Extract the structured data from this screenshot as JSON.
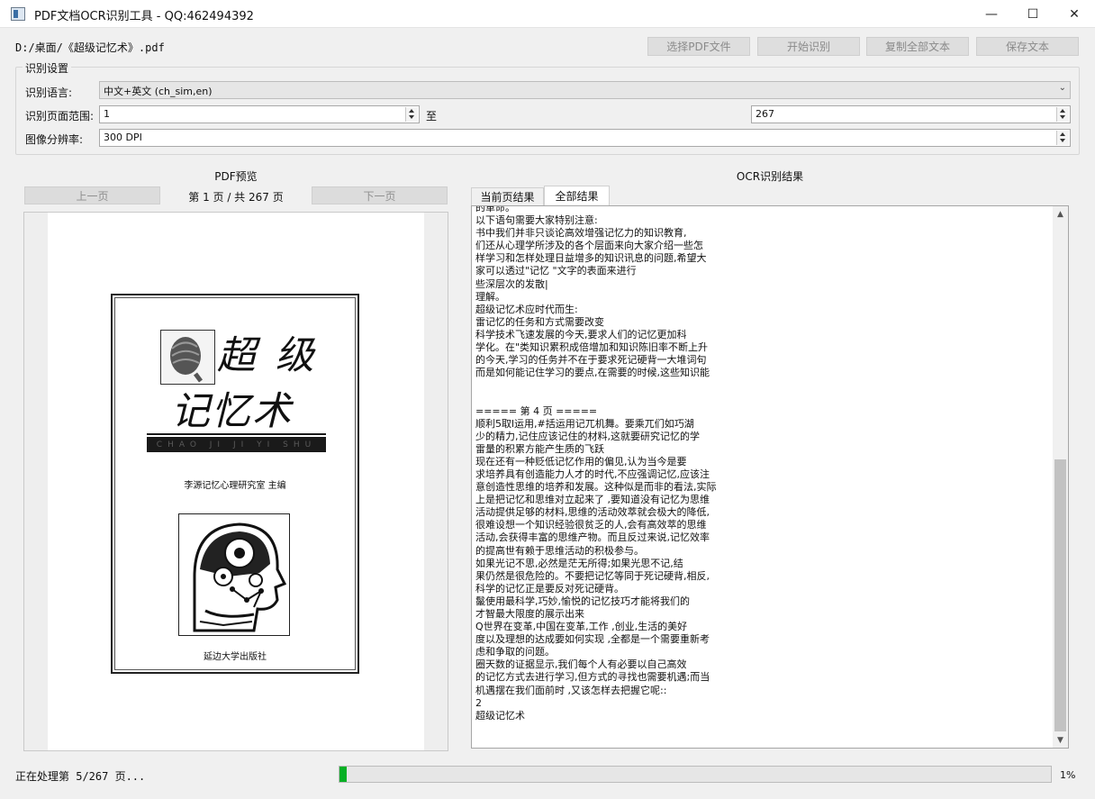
{
  "window": {
    "title": "PDF文档OCR识别工具 - QQ:462494392",
    "minimize": "—",
    "maximize": "☐",
    "close": "✕",
    "icon": "app-icon"
  },
  "toolbar": {
    "file_path": "D:/桌面/《超级记忆术》.pdf",
    "select_pdf": "选择PDF文件",
    "start": "开始识别",
    "copy_all": "复制全部文本",
    "save": "保存文本"
  },
  "settings": {
    "group_title": "识别设置",
    "language_label": "识别语言:",
    "language_value": "中文+英文 (ch_sim,en)",
    "range_label": "识别页面范围:",
    "range_from": "1",
    "range_to_label": "至",
    "range_to": "267",
    "dpi_label": "图像分辨率:",
    "dpi_value": "300 DPI"
  },
  "preview": {
    "title": "PDF预览",
    "prev_button": "上一页",
    "next_button": "下一页",
    "page_info": "第 1 页 / 共 267 页",
    "cover": {
      "title_line1": "超 级",
      "title_line2": "记忆术",
      "pinyin": "CHAO JI JI YI SHU",
      "editor": "李源记忆心理研究室  主编",
      "publisher": "延边大学出版社"
    }
  },
  "ocr": {
    "title": "OCR识别结果",
    "tab_current": "当前页结果",
    "tab_all": "全部结果",
    "text_lines": [
      "的革命。",
      "以下语句需要大家特别注意:",
      "书中我们并非只谈论高效增强记忆力的知识教育,",
      "们还从心理学所涉及的各个层面来向大家介绍一些怎",
      "样学习和怎样处理日益增多的知识讯息的问题,希望大",
      "家可以透过\"记忆 \"文字的表面来进行",
      "些深层次的发散|",
      "理解。",
      "超级记忆术应时代而生:",
      "雷记忆的任务和方式需要改变",
      "科学技术飞速发展的今天,要求人们的记忆更加科",
      "学化。在\"类知识累积成倍增加和知识陈旧率不断上升",
      "的今天,学习的任务并不在于要求死记硬背一大堆词句",
      "而是如何能记住学习的要点,在需要的时候,这些知识能",
      "",
      "",
      "===== 第 4 页 =====",
      "顺利5取l运用,#括运用记兀机舞。要乘兀们如巧湖",
      "少的精力,记住应该记住的材料,这就要研究记忆的学",
      "雷量的积累方能产生质的飞跃",
      "现在还有一种贬低记忆作用的偏见,认为当今是要",
      "求培养具有创造能力人才的时代,不应强调记忆,应该注",
      "意创造性思维的培养和发展。这种似是而非的看法,实际",
      "上是把记忆和思维对立起来了 ,要知道没有记忆为思维",
      "活动提供足够的材料,思维的活动效萃就会极大的降低,",
      "很难设想一个知识经验很贫乏的人,会有高效萃的思维",
      "活动,会获得丰富的思维产物。而且反过来说,记忆效率",
      "的提高世有赖于思维活动的积极参与。",
      "如果光记不思,必然是茫无所得;如果光思不记,结",
      "果仍然是很危险的。不要把记忆等同于死记硬背,相反,",
      "科学的记忆正是要反对死记硬背。",
      "鬣使用最科学,巧妙,愉悦的记忆技巧才能将我们的",
      "才智最大限度的展示出来",
      "Q世界在变革,中国在变革,工作 ,创业,生活的美好",
      "度以及理想的达成要如何实现 ,全都是一个需要重新考",
      "虑和争取的问题。",
      "圈天数的证据显示,我们每个人有必要以自己高效",
      "的记忆方式去进行学习,但方式的寻找也需要机遇;而当",
      "机遇摆在我们面前时 ,又该怎样去把握它呢::",
      "2",
      "超级记忆术"
    ]
  },
  "status": {
    "text": "正在处理第 5/267 页...",
    "progress_percent": 1,
    "progress_label": "1%",
    "progress_color": "#06b025"
  }
}
